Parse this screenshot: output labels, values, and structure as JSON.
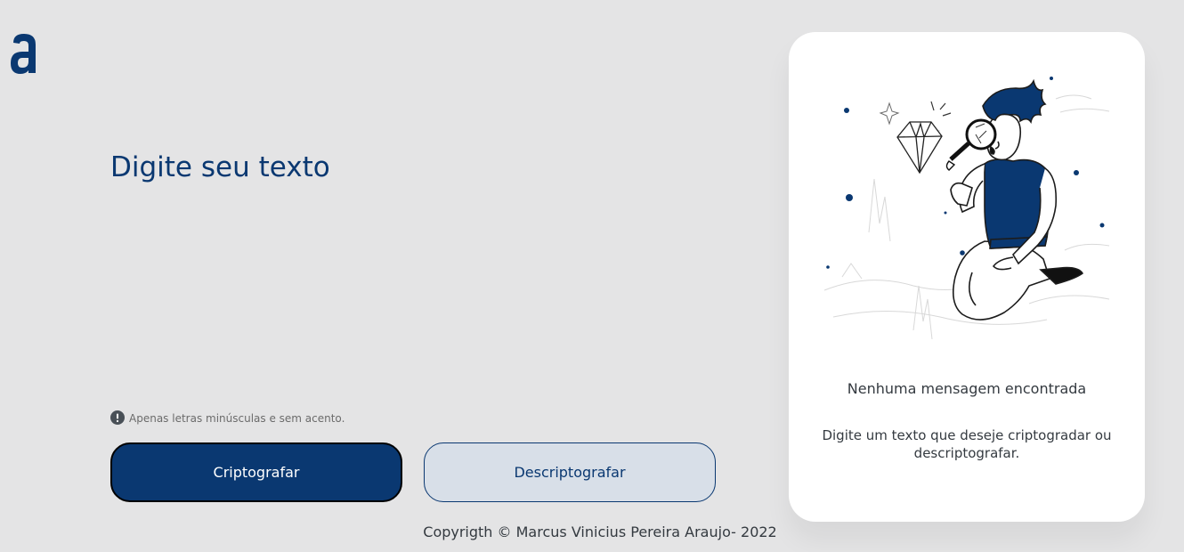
{
  "brand": {
    "logo_icon": "alura-a-logo-icon",
    "accent_color": "#0a3871"
  },
  "editor": {
    "placeholder": "Digite seu texto",
    "value": ""
  },
  "hint": {
    "icon": "exclamation-circle-icon",
    "text": "Apenas letras minúsculas e sem acento."
  },
  "actions": {
    "encrypt_label": "Criptografar",
    "decrypt_label": "Descriptografar"
  },
  "output_panel": {
    "illustration": "person-with-magnifying-glass-illustration",
    "title": "Nenhuma mensagem encontrada",
    "description": "Digite um texto que deseje criptogradar ou descriptografar."
  },
  "footer": {
    "text": "Copyrigth © Marcus Vinicius Pereira Araujo- 2022"
  }
}
